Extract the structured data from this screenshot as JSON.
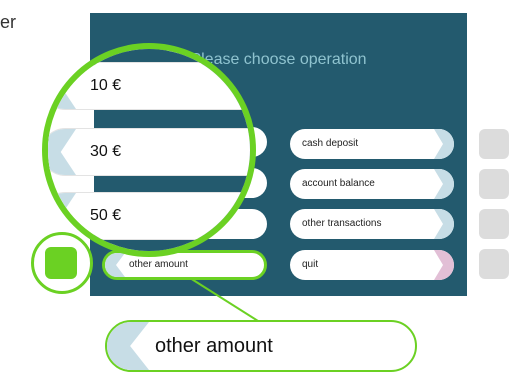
{
  "top_text": "er",
  "screen": {
    "title": "Please choose operation",
    "right_options": [
      {
        "label": "cash deposit"
      },
      {
        "label": "account balance"
      },
      {
        "label": "other transactions"
      },
      {
        "label": "quit"
      }
    ],
    "left_options": [
      {
        "label": "other amount"
      }
    ]
  },
  "magnifier": {
    "options": [
      {
        "label": "10 €"
      },
      {
        "label": "30 €"
      },
      {
        "label": "50 €"
      }
    ]
  },
  "callout": {
    "label": "other amount"
  },
  "colors": {
    "screen_bg": "#235a6e",
    "title": "#8fc3cf",
    "highlight": "#6bd123",
    "chevron": "#c7dde6",
    "quit_chevron": "#e2bfd6",
    "side_key": "#dcdcdc"
  }
}
